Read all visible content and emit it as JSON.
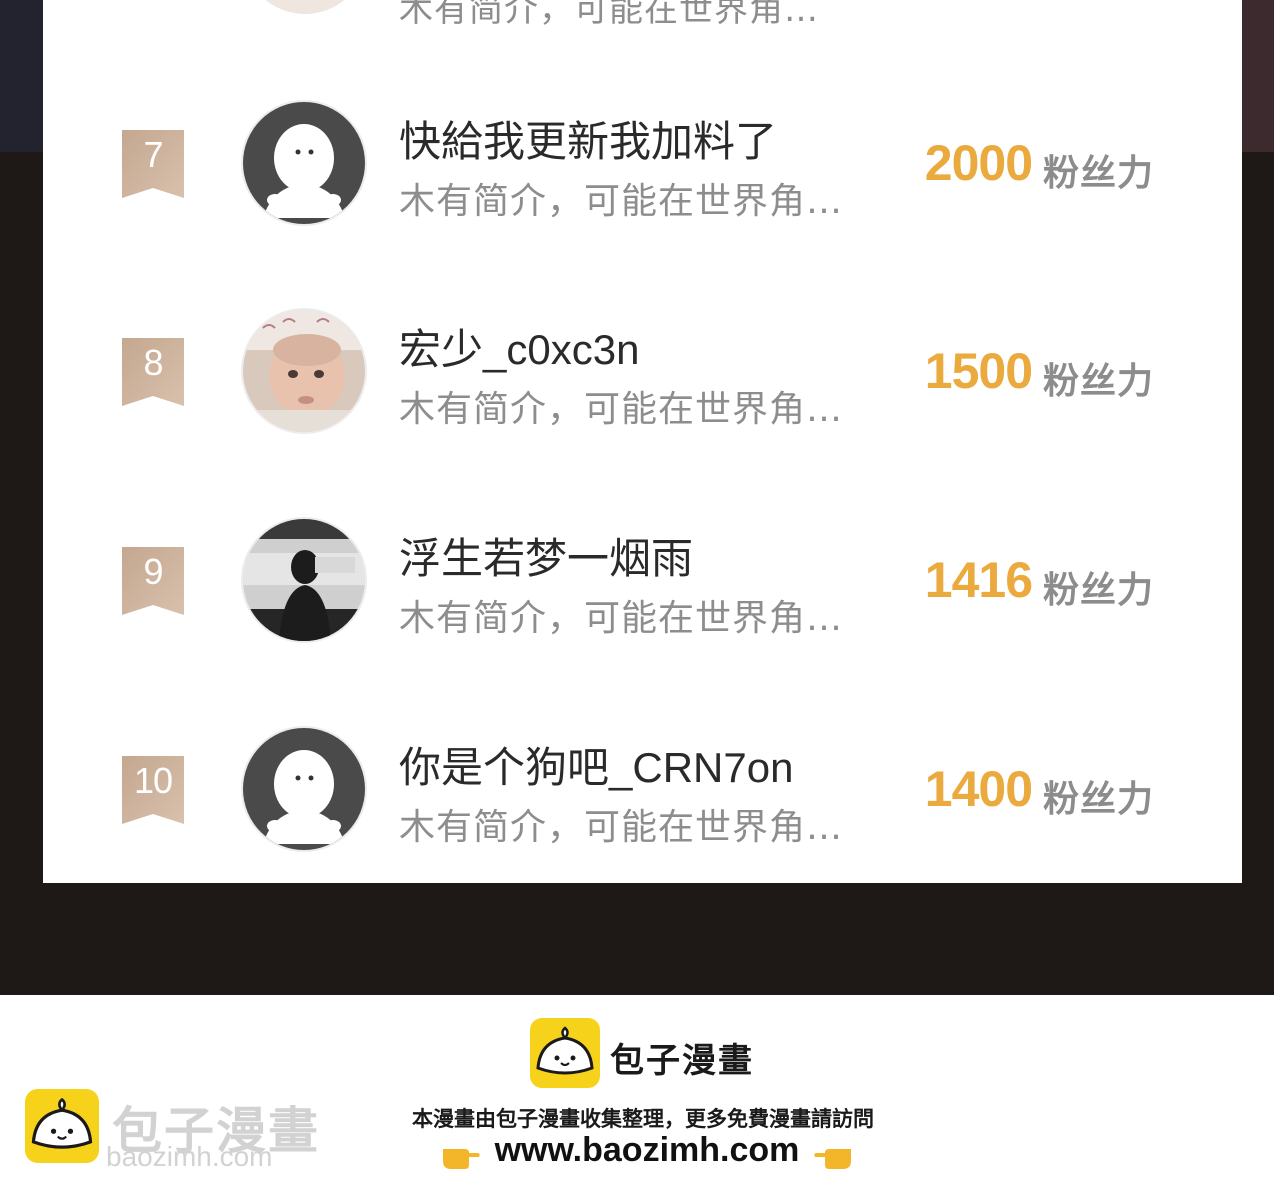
{
  "leaderboard": {
    "peek_row": {
      "bio": "木有简介，可能在世界角…"
    },
    "score_unit": "粉丝力",
    "rows": [
      {
        "rank": "7",
        "name": "快給我更新我加料了",
        "bio": "木有简介，可能在世界角…",
        "score": "2000",
        "avatar": "default-avatar-icon"
      },
      {
        "rank": "8",
        "name": "宏少_c0xc3n",
        "bio": "木有简介，可能在世界角…",
        "score": "1500",
        "avatar": "baby-photo-avatar"
      },
      {
        "rank": "9",
        "name": "浮生若梦一烟雨",
        "bio": "木有简介，可能在世界角…",
        "score": "1416",
        "avatar": "silhouette-photo-avatar"
      },
      {
        "rank": "10",
        "name": "你是个狗吧_CRN7on",
        "bio": "木有简介，可能在世界角…",
        "score": "1400",
        "avatar": "default-avatar-icon"
      }
    ]
  },
  "footer": {
    "brand_name": "包子漫畫",
    "note": "本漫畫由包子漫畫收集整理，更多免費漫畫請訪問",
    "url": "www.baozimh.com",
    "watermark_name": "包子漫畫",
    "watermark_url": "baozimh.com"
  },
  "colors": {
    "score": "#eaaa3e",
    "rank_badge": "#c9ad96",
    "dark_band": "#1e1817",
    "brand_yellow": "#f7d21b"
  }
}
